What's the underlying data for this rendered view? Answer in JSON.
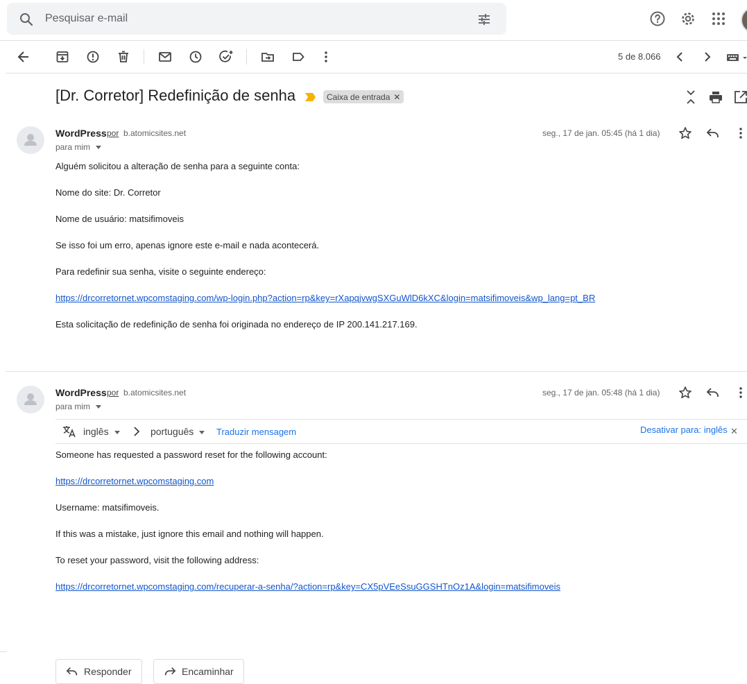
{
  "search": {
    "placeholder": "Pesquisar e-mail"
  },
  "toolbar": {
    "counter": "5 de 8.066"
  },
  "subject": "[Dr. Corretor] Redefinição de senha",
  "label": "Caixa de entrada",
  "messages": [
    {
      "sender": "WordPress",
      "via": "por",
      "domain": "b.atomicsites.net",
      "to": "para mim",
      "date": "seg., 17 de jan. 05:45 (há 1 dia)",
      "lines": [
        "Alguém solicitou a alteração de senha para a seguinte conta:",
        "Nome do site: Dr. Corretor",
        "Nome de usuário: matsifimoveis",
        "Se isso foi um erro, apenas ignore este e-mail e nada acontecerá.",
        "Para redefinir sua senha, visite o seguinte endereço:",
        "https://drcorretornet.wpcomstaging.com/wp-login.php?action=rp&key=rXapqjvwgSXGuWlD6kXC&login=matsifimoveis&wp_lang=pt_BR",
        "Esta solicitação de redefinição de senha foi originada no endereço de IP 200.141.217.169."
      ]
    },
    {
      "sender": "WordPress",
      "via": "por",
      "domain": "b.atomicsites.net",
      "to": "para mim",
      "date": "seg., 17 de jan. 05:48 (há 1 dia)",
      "lines": [
        "Someone has requested a password reset for the following account:",
        "https://drcorretornet.wpcomstaging.com",
        "Username: matsifimoveis.",
        "If this was a mistake, just ignore this email and nothing will happen.",
        "To reset your password, visit the following address:",
        "https://drcorretornet.wpcomstaging.com/recuperar-a-senha/?action=rp&key=CX5pVEeSsuGGSHTnOz1A&login=matsifimoveis"
      ]
    }
  ],
  "translate": {
    "from": "inglês",
    "to": "português",
    "action": "Traduzir mensagem",
    "disable": "Desativar para: inglês"
  },
  "actions": {
    "reply": "Responder",
    "forward": "Encaminhar"
  }
}
